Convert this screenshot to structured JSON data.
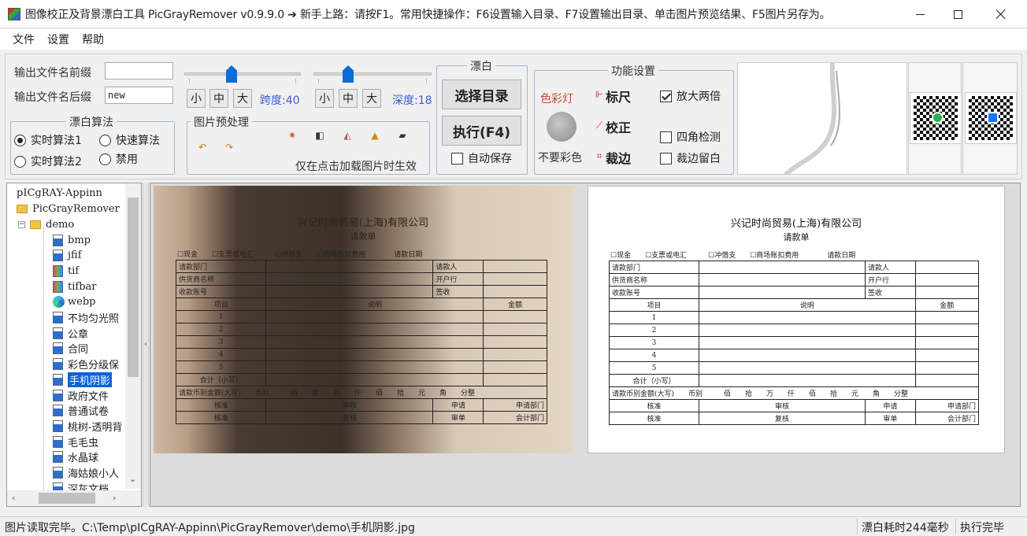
{
  "window": {
    "title": "图像校正及背景漂白工具 PicGrayRemover v0.9.9.0 ➔ 新手上路：请按F1。常用快捷操作：F6设置输入目录、F7设置输出目录、单击图片预览结果、F5图片另存为。"
  },
  "menu": [
    "文件",
    "设置",
    "帮助"
  ],
  "output": {
    "prefix_label": "输出文件名前缀",
    "prefix_value": "",
    "suffix_label": "输出文件名后缀",
    "suffix_value": "new"
  },
  "bleach_algorithm": {
    "title": "漂白算法",
    "options": [
      "实时算法1",
      "快速算法",
      "实时算法2",
      "禁用"
    ],
    "selected": "实时算法1"
  },
  "span_slider": {
    "buttons": [
      "小",
      "中",
      "大"
    ],
    "label": "跨度:40",
    "value": 40
  },
  "depth_slider": {
    "buttons": [
      "小",
      "中",
      "大"
    ],
    "label": "深度:18",
    "value": 18
  },
  "preprocess": {
    "title": "图片预处理",
    "note": "仅在点击加载图片时生效",
    "icons": [
      "undo-icon",
      "redo-icon",
      "brightness-icon",
      "contrast-icon",
      "levels-icon",
      "triangle-icon",
      "eraser-icon"
    ]
  },
  "bleach": {
    "title": "漂白",
    "select_dir": "选择目录",
    "execute": "执行(F4)",
    "auto_save": "自动保存",
    "auto_save_checked": false
  },
  "features": {
    "title": "功能设置",
    "color_light": "色彩灯",
    "no_color": "不要彩色",
    "ruler": "标尺",
    "correct": "校正",
    "crop": "裁边",
    "zoom2x": "放大两倍",
    "zoom2x_checked": true,
    "corner_detect": "四角检测",
    "corner_detect_checked": false,
    "crop_margin": "裁边留白",
    "crop_margin_checked": false
  },
  "tree": {
    "root": "pICgRAY-Appinn",
    "folder": "PicGrayRemover",
    "subfolder": "demo",
    "items": [
      {
        "label": "bmp",
        "icon": "image-file-icon"
      },
      {
        "label": "jfif",
        "icon": "image-file-icon"
      },
      {
        "label": "tif",
        "icon": "tif-file-icon"
      },
      {
        "label": "tifbar",
        "icon": "tif-file-icon"
      },
      {
        "label": "webp",
        "icon": "edge-icon"
      },
      {
        "label": "不均匀光照",
        "icon": "image-file-icon"
      },
      {
        "label": "公章",
        "icon": "image-file-icon"
      },
      {
        "label": "合同",
        "icon": "image-file-icon"
      },
      {
        "label": "彩色分级保",
        "icon": "image-file-icon"
      },
      {
        "label": "手机阴影",
        "icon": "image-file-icon",
        "selected": true
      },
      {
        "label": "政府文件",
        "icon": "image-file-icon"
      },
      {
        "label": "普通试卷",
        "icon": "image-file-icon"
      },
      {
        "label": "桃树-透明背",
        "icon": "image-file-icon"
      },
      {
        "label": "毛毛虫",
        "icon": "image-file-icon"
      },
      {
        "label": "水晶球",
        "icon": "image-file-icon"
      },
      {
        "label": "海姑娘小人",
        "icon": "image-file-icon"
      },
      {
        "label": "深灰文档",
        "icon": "image-file-icon"
      }
    ]
  },
  "document": {
    "company": "兴记时尚贸易(上海)有限公司",
    "form_name": "请款单",
    "checkboxes": "☐现金　　☐支票或电汇　　　☐冲借支　　☐商场账扣费用　　　　请款日期",
    "rows": [
      [
        "请款部门",
        "",
        "请款人",
        ""
      ],
      [
        "供货商名称",
        "",
        "开户行",
        ""
      ],
      [
        "收款账号",
        "",
        "签收",
        ""
      ]
    ],
    "header": [
      "项目",
      "说明",
      "金额"
    ],
    "items": [
      "1",
      "2",
      "3",
      "4",
      "5",
      "合计（小写）"
    ],
    "amount_row": "请款币别金额(大写)　　币别　　　佰　　拾　　万　　仟　　佰　　拾　　元　　角　　分整",
    "approve_row1": [
      "核准",
      "审核",
      "申请",
      "申请部门"
    ],
    "approve_row2": [
      "核准",
      "复核",
      "审单",
      "会计部门"
    ]
  },
  "status": {
    "left": "图片读取完毕。C:\\Temp\\pICgRAY-Appinn\\PicGrayRemover\\demo\\手机阴影.jpg",
    "timing": "漂白耗时244毫秒",
    "state": "执行完毕"
  },
  "colors": {
    "accent": "#0a6cd6",
    "selection": "#0a64d8",
    "blue_label": "#3a5ecf",
    "red_icon": "#d22"
  }
}
